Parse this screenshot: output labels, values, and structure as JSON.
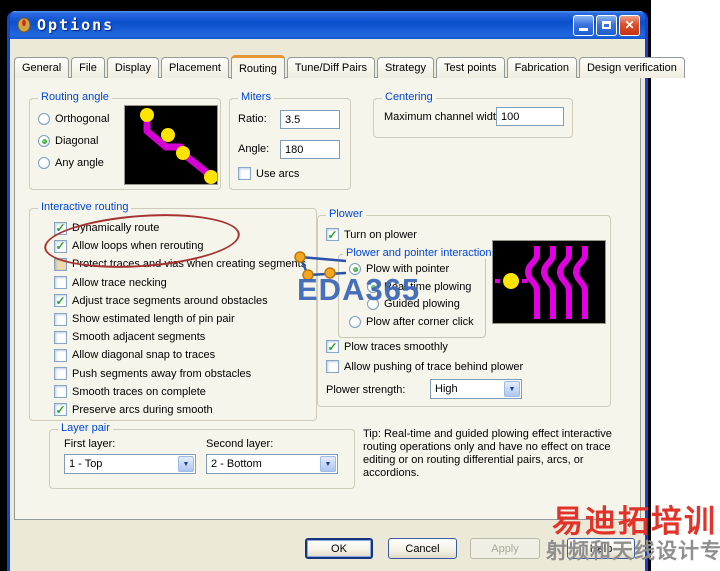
{
  "window": {
    "title": "Options",
    "controls": {
      "close_glyph": "✕"
    }
  },
  "tabs": {
    "items": [
      {
        "label": "General",
        "state": ""
      },
      {
        "label": "File",
        "state": ""
      },
      {
        "label": "Display",
        "state": ""
      },
      {
        "label": "Placement",
        "state": ""
      },
      {
        "label": "Routing",
        "state": "selected"
      },
      {
        "label": "Tune/Diff Pairs",
        "state": ""
      },
      {
        "label": "Strategy",
        "state": ""
      },
      {
        "label": "Test points",
        "state": ""
      },
      {
        "label": "Fabrication",
        "state": ""
      },
      {
        "label": "Design verification",
        "state": ""
      }
    ]
  },
  "routing_angle": {
    "caption": "Routing angle",
    "options": [
      {
        "label": "Orthogonal",
        "state": ""
      },
      {
        "label": "Diagonal",
        "state": "selected"
      },
      {
        "label": "Any angle",
        "state": ""
      }
    ]
  },
  "miters": {
    "caption": "Miters",
    "ratio_label": "Ratio:",
    "ratio_value": "3.5",
    "angle_label": "Angle:",
    "angle_value": "180",
    "use_arcs_label": "Use arcs",
    "use_arcs_glyph": ""
  },
  "centering": {
    "caption": "Centering",
    "width_label": "Maximum channel width:",
    "width_value": "100"
  },
  "interactive_routing": {
    "caption": "Interactive routing",
    "checkboxes": [
      {
        "label": "Dynamically route",
        "glyph": "✓",
        "state": ""
      },
      {
        "label": "Allow loops when rerouting",
        "glyph": "✓",
        "state": ""
      },
      {
        "label": "Protect traces and vias when creating segments",
        "glyph": "",
        "state": "grayed"
      },
      {
        "label": "Allow trace necking",
        "glyph": "",
        "state": ""
      },
      {
        "label": "Adjust trace segments around obstacles",
        "glyph": "✓",
        "state": ""
      },
      {
        "label": "Show estimated length of pin pair",
        "glyph": "",
        "state": ""
      },
      {
        "label": "Smooth adjacent segments",
        "glyph": "",
        "state": ""
      },
      {
        "label": "Allow diagonal snap to traces",
        "glyph": "",
        "state": ""
      },
      {
        "label": "Push segments away from obstacles",
        "glyph": "",
        "state": ""
      },
      {
        "label": "Smooth traces on complete",
        "glyph": "",
        "state": ""
      },
      {
        "label": "Preserve arcs during smooth",
        "glyph": "✓",
        "state": ""
      }
    ]
  },
  "plower": {
    "caption": "Plower",
    "turn_on": {
      "label": "Turn on plower",
      "glyph": "✓"
    },
    "interaction": {
      "caption": "Plower and pointer interaction",
      "radios": [
        {
          "label": "Plow with pointer",
          "state": "selected"
        },
        {
          "label": "Real-time plowing",
          "state": "selected"
        },
        {
          "label": "Guided plowing",
          "state": ""
        },
        {
          "label": "Plow after corner click",
          "state": ""
        }
      ]
    },
    "smooth": {
      "label": "Plow traces smoothly",
      "glyph": "✓"
    },
    "push_behind": {
      "label": "Allow pushing of trace behind plower",
      "glyph": ""
    },
    "strength_label": "Plower strength:",
    "strength_value": "High"
  },
  "layer_pair": {
    "caption": "Layer pair",
    "first_label": "First layer:",
    "first_value": "1 - Top",
    "second_label": "Second layer:",
    "second_value": "2 - Bottom"
  },
  "tip": "Tip: Real-time and guided plowing effect interactive routing operations only and have no effect on trace editing or on routing differential pairs, arcs, or accordions.",
  "action_buttons": [
    {
      "label": "OK",
      "state": "default"
    },
    {
      "label": "Cancel",
      "state": ""
    },
    {
      "label": "Apply",
      "state": "disabled"
    },
    {
      "label": "Help",
      "state": ""
    }
  ],
  "watermarks": {
    "eda": "EDA365",
    "red_cn": "易迪拓培训",
    "gray_cn": "射频和天线设计专家"
  },
  "colors": {
    "titlebar_blue": "#0b4fcc",
    "tab_accent_orange": "#e5953a",
    "group_caption_blue": "#0046d5",
    "check_green": "#2da32d",
    "trace_magenta": "#d400d4",
    "pad_yellow": "#ffe400",
    "watermark_red": "#e0332a",
    "watermark_blue": "#4a72bd"
  }
}
